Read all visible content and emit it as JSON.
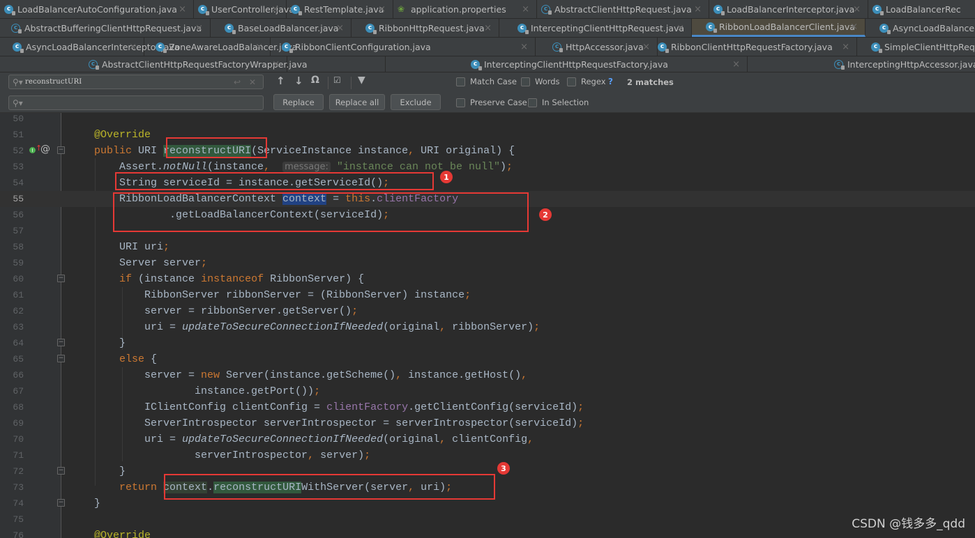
{
  "tab_rows": [
    [
      {
        "label": "LoadBalancerAutoConfiguration.java",
        "icon": "class-icon"
      },
      {
        "label": "UserController.java",
        "icon": "class-icon"
      },
      {
        "label": "RestTemplate.java",
        "icon": "class-icon"
      },
      {
        "label": "application.properties",
        "icon": "spring-properties-icon"
      },
      {
        "label": "AbstractClientHttpRequest.java",
        "icon": "abstract-class-icon"
      },
      {
        "label": "LoadBalancerInterceptor.java",
        "icon": "class-icon"
      },
      {
        "label": "LoadBalancerRec",
        "icon": "class-icon"
      }
    ],
    [
      {
        "label": "AbstractBufferingClientHttpRequest.java",
        "icon": "abstract-class-icon"
      },
      {
        "label": "BaseLoadBalancer.java",
        "icon": "class-icon"
      },
      {
        "label": "RibbonHttpRequest.java",
        "icon": "class-icon"
      },
      {
        "label": "InterceptingClientHttpRequest.java",
        "icon": "class-icon"
      },
      {
        "label": "RibbonLoadBalancerClient.java",
        "icon": "class-icon",
        "active": true
      },
      {
        "label": "AsyncLoadBalancerI",
        "icon": "class-icon"
      }
    ],
    [
      {
        "label": "AsyncLoadBalancerInterceptor.java",
        "icon": "class-icon"
      },
      {
        "label": "ZoneAwareLoadBalancer.java",
        "icon": "class-icon"
      },
      {
        "label": "RibbonClientConfiguration.java",
        "icon": "class-icon"
      },
      {
        "label": "HttpAccessor.java",
        "icon": "abstract-class-icon"
      },
      {
        "label": "RibbonClientHttpRequestFactory.java",
        "icon": "class-icon"
      },
      {
        "label": "SimpleClientHttpRequ",
        "icon": "class-icon"
      }
    ],
    [
      {
        "label": "AbstractClientHttpRequestFactoryWrapper.java",
        "icon": "abstract-class-icon"
      },
      {
        "label": "InterceptingClientHttpRequestFactory.java",
        "icon": "class-icon"
      },
      {
        "label": "InterceptingHttpAccessor.java",
        "icon": "abstract-class-icon"
      }
    ]
  ],
  "search": {
    "find_value": "reconstructURI",
    "replace_value": "",
    "replace_label": "Replace",
    "replace_all_label": "Replace all",
    "exclude_label": "Exclude",
    "match_case_label": "Match Case",
    "words_label": "Words",
    "regex_label": "Regex",
    "help_label": "?",
    "matches_label": "2 matches",
    "preserve_case_label": "Preserve Case",
    "in_selection_label": "In Selection",
    "match_case": false,
    "words": false,
    "regex": false,
    "preserve_case": false,
    "in_selection": false
  },
  "editor": {
    "current_line": 55,
    "line_numbers": [
      "50",
      "51",
      "52",
      "53",
      "54",
      "55",
      "56",
      "57",
      "58",
      "59",
      "60",
      "61",
      "62",
      "63",
      "64",
      "65",
      "66",
      "67",
      "68",
      "69",
      "70",
      "71",
      "72",
      "73",
      "74",
      "75",
      "76"
    ],
    "param_hint": "message:",
    "annotations": [
      "1",
      "2",
      "3"
    ]
  },
  "watermark": "CSDN @钱多多_qdd",
  "colors": {
    "keyword": "#cc7832",
    "annotation": "#bbb529",
    "string": "#6a8759",
    "field": "#9876aa",
    "plain": "#a9b7c6",
    "highlight_box": "#e53935",
    "active_tab_underline": "#4a88c7"
  }
}
